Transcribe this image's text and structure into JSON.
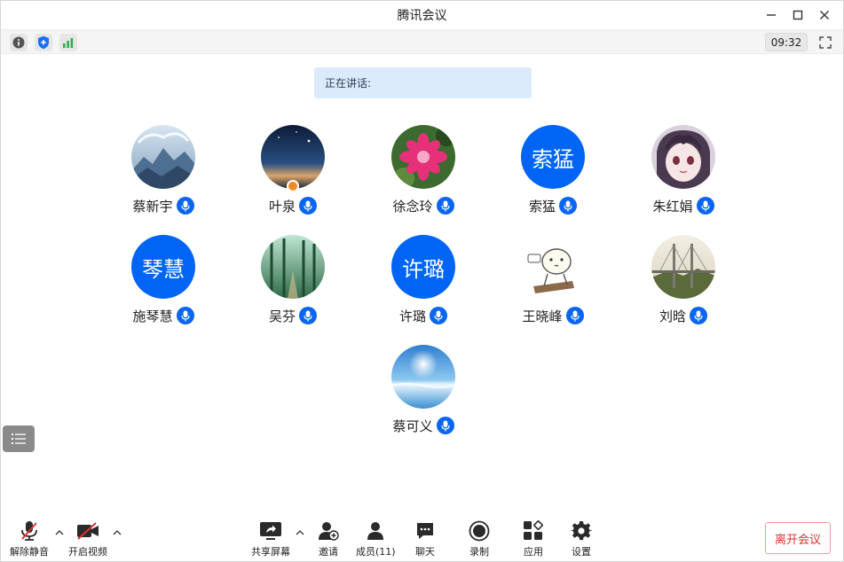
{
  "window": {
    "title": "腾讯会议"
  },
  "infobar": {
    "timer": "09:32"
  },
  "speaking": {
    "label": "正在讲话:"
  },
  "participants": [
    {
      "name": "蔡新宇",
      "avatar": "landscape-photo"
    },
    {
      "name": "叶泉",
      "avatar": "night-sky-photo"
    },
    {
      "name": "徐念玲",
      "avatar": "flower-photo"
    },
    {
      "name": "索猛",
      "avatar_text": "索猛"
    },
    {
      "name": "朱红娟",
      "avatar": "anime-girl-photo"
    },
    {
      "name": "施琴慧",
      "avatar_text": "琴慧"
    },
    {
      "name": "吴芬",
      "avatar": "forest-photo"
    },
    {
      "name": "许璐",
      "avatar_text": "许璐"
    },
    {
      "name": "王晓峰",
      "avatar": "cartoon-sticker"
    },
    {
      "name": "刘晗",
      "avatar": "bridge-photo"
    },
    {
      "name": "蔡可义",
      "avatar": "sea-sky-photo"
    }
  ],
  "toolbar": {
    "unmute": "解除静音",
    "start_video": "开启视频",
    "share_screen": "共享屏幕",
    "invite": "邀请",
    "members": "成员(11)",
    "chat": "聊天",
    "record": "录制",
    "apps": "应用",
    "settings": "设置",
    "leave": "离开会议"
  },
  "colors": {
    "accent": "#0064f5",
    "leave": "#e03030",
    "speaking_bg": "#dcebfc"
  }
}
